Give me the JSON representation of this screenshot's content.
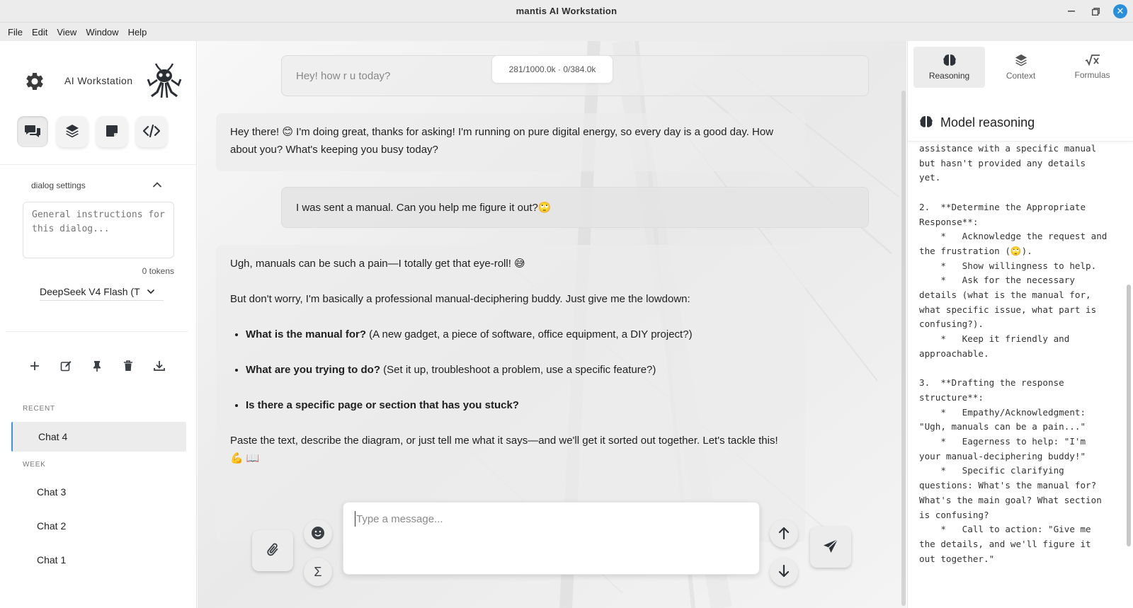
{
  "window": {
    "title": "mantis AI Workstation",
    "minimize_icon": "minimize-icon",
    "maximize_icon": "maximize-icon",
    "close_icon": "close-icon"
  },
  "menu": [
    "File",
    "Edit",
    "View",
    "Window",
    "Help"
  ],
  "sidebar": {
    "brand": "AI Workstation",
    "mode_buttons": [
      {
        "name": "chat-mode",
        "icon": "chat-bubbles-icon"
      },
      {
        "name": "layers-mode",
        "icon": "layers-icon"
      },
      {
        "name": "notes-mode",
        "icon": "note-icon"
      },
      {
        "name": "code-mode",
        "icon": "code-icon"
      }
    ],
    "dialog_settings": {
      "label": "dialog settings",
      "placeholder": "General instructions for this dialog...",
      "tokens": "0 tokens"
    },
    "model": "DeepSeek V4 Flash (T",
    "groups": [
      {
        "label": "RECENT",
        "chats": [
          "Chat 4"
        ]
      },
      {
        "label": "WEEK",
        "chats": [
          "Chat 3",
          "Chat 2",
          "Chat 1"
        ]
      }
    ],
    "active_chat": "Chat 4"
  },
  "chat": {
    "token_counter": "281/1000.0k · 0/384.0k",
    "messages": [
      {
        "role": "user",
        "text": "Hey! how r u today?"
      },
      {
        "role": "assistant",
        "text": "Hey there! 😊 I'm doing great, thanks for asking! I'm running on pure digital energy, so every day is a good day. How about you? What's keeping you busy today?"
      },
      {
        "role": "user",
        "text": "I was sent a manual. Can you help me figure it out?🙄"
      },
      {
        "role": "assistant",
        "intro1": "Ugh, manuals can be such a pain—I totally get that eye-roll! 😅",
        "intro2": "But don't worry, I'm basically a professional manual-deciphering buddy. Just give me the lowdown:",
        "bullets": [
          {
            "bold": "What is the manual for?",
            "rest": " (A new gadget, a piece of software, office equipment, a DIY project?)"
          },
          {
            "bold": "What are you trying to do?",
            "rest": " (Set it up, troubleshoot a problem, use a specific feature?)"
          },
          {
            "bold": "Is there a specific page or section that has you stuck?",
            "rest": ""
          }
        ],
        "outro": "Paste the text, describe the diagram, or just tell me what it says—and we'll get it sorted out together. Let's tackle this! 💪 📖"
      }
    ],
    "composer": {
      "placeholder": "Type a message..."
    }
  },
  "right_panel": {
    "tabs": [
      {
        "label": "Reasoning",
        "icon": "brain-icon",
        "active": true
      },
      {
        "label": "Context",
        "icon": "layers-icon",
        "active": false
      },
      {
        "label": "Formulas",
        "icon": "sqrt-x-icon",
        "active": false
      }
    ],
    "heading": "Model reasoning",
    "reasoning_text": "assistance with a specific manual\nbut hasn't provided any details\nyet.\n\n2.  **Determine the Appropriate\nResponse**:\n    *   Acknowledge the request and\nthe frustration (🙄).\n    *   Show willingness to help.\n    *   Ask for the necessary\ndetails (what is the manual for,\nwhat specific issue, what part is\nconfusing?).\n    *   Keep it friendly and\napproachable.\n\n3.  **Drafting the response\nstructure**:\n    *   Empathy/Acknowledgment:\n\"Ugh, manuals can be a pain...\"\n    *   Eagerness to help: \"I'm\nyour manual-deciphering buddy!\"\n    *   Specific clarifying\nquestions: What's the manual for?\nWhat's the main goal? What section\nis confusing?\n    *   Call to action: \"Give me\nthe details, and we'll figure it\nout together.\""
  }
}
